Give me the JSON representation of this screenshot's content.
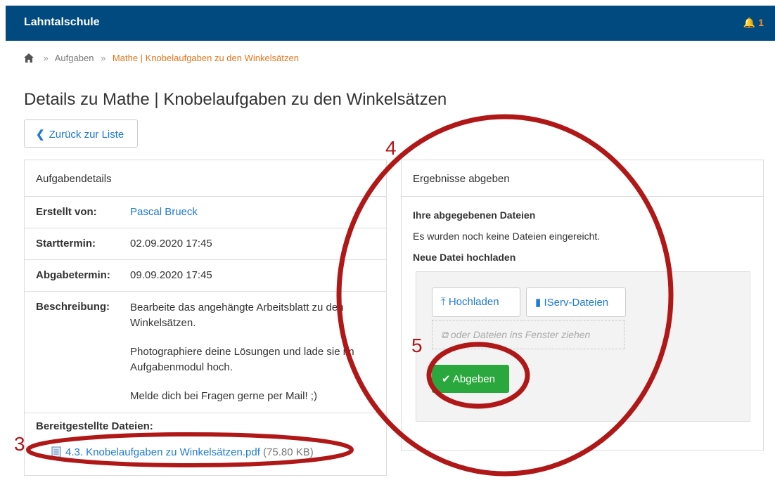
{
  "navbar": {
    "title": "Lahntalschule",
    "notifications": "1",
    "bell_icon": "bell-icon"
  },
  "breadcrumb": {
    "home_icon": "home-icon",
    "sep": "»",
    "items": [
      "Aufgaben",
      "Mathe | Knobelaufgaben zu den Winkelsätzen"
    ]
  },
  "page_title": "Details zu Mathe | Knobelaufgaben zu den Winkelsätzen",
  "back_button": "Zurück zur Liste",
  "details": {
    "heading": "Aufgabendetails",
    "created_by_label": "Erstellt von:",
    "created_by": "Pascal Brueck",
    "start_label": "Starttermin:",
    "start": "02.09.2020 17:45",
    "due_label": "Abgabetermin:",
    "due": "09.09.2020 17:45",
    "desc_label": "Beschreibung:",
    "desc": [
      "Bearbeite das angehängte Arbeitsblatt zu den Winkelsätzen.",
      "Photographiere deine Lösungen und lade sie im Aufgabenmodul hoch.",
      "Melde dich bei Fragen gerne per Mail! ;)"
    ],
    "files_label": "Bereitgestellte Dateien:",
    "file_name": "4.3. Knobelaufgaben zu Winkelsätzen.pdf",
    "file_size": "(75.80 KB)"
  },
  "submit_panel": {
    "heading": "Ergebnisse abgeben",
    "your_files": "Ihre abgegebenen Dateien",
    "none": "Es wurden noch keine Dateien eingereicht.",
    "new_upload": "Neue Datei hochladen",
    "upload_btn": "Hochladen",
    "iserv_btn": "IServ-Dateien",
    "dropzone": "oder Dateien ins Fenster ziehen",
    "submit_btn": "Abgeben"
  },
  "annotations": {
    "n3": "3",
    "n4": "4",
    "n5": "5",
    "color": "#b01818"
  },
  "colors": {
    "navbar": "#004a80",
    "link": "#1f7ad6",
    "accent": "#e8731a",
    "submit": "#2ba83d"
  }
}
